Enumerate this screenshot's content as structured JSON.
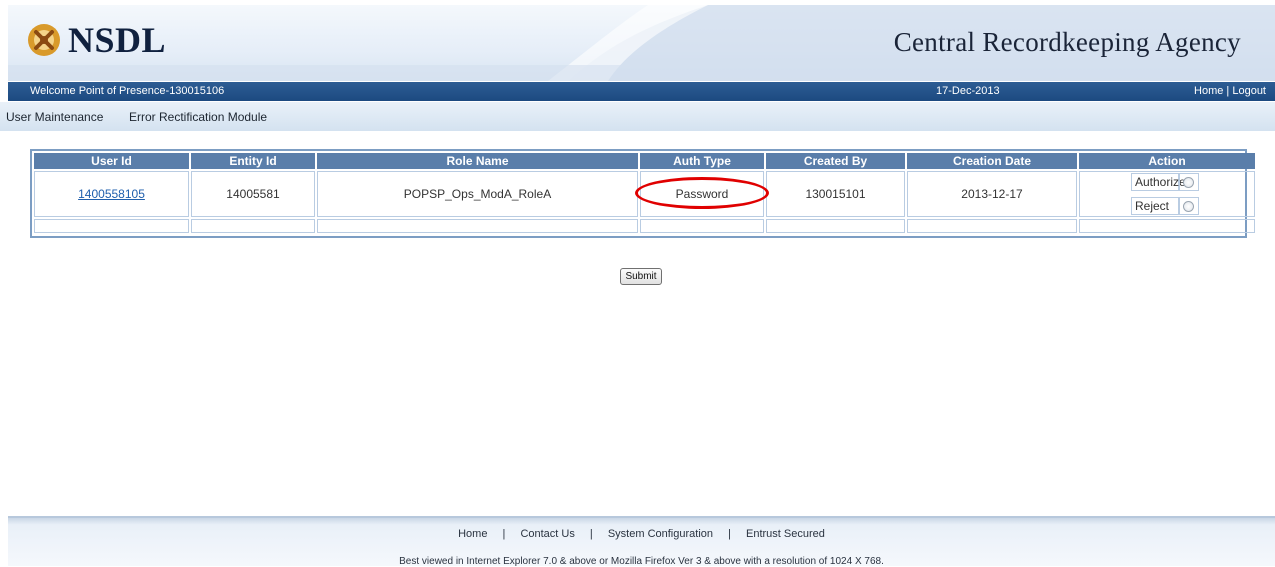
{
  "header": {
    "logo_text": "NSDL",
    "agency_title": "Central Recordkeeping Agency"
  },
  "welcome_bar": {
    "welcome_text": "Welcome Point of Presence-130015106",
    "date": "17-Dec-2013",
    "home_link": "Home",
    "separator": "|",
    "logout_link": "Logout"
  },
  "menu": {
    "items": [
      {
        "label": "User Maintenance"
      },
      {
        "label": "Error Rectification Module"
      }
    ]
  },
  "table": {
    "columns": [
      "User Id",
      "Entity Id",
      "Role Name",
      "Auth Type",
      "Created By",
      "Creation Date",
      "Action"
    ],
    "rows": [
      {
        "user_id": "1400558105",
        "entity_id": "14005581",
        "role_name": "POPSP_Ops_ModA_RoleA",
        "auth_type": "Password",
        "created_by": "130015101",
        "creation_date": "2013-12-17",
        "actions": [
          {
            "label": "Authorize",
            "selected": false
          },
          {
            "label": "Reject",
            "selected": false
          }
        ]
      }
    ]
  },
  "submit_label": "Submit",
  "footer": {
    "links": [
      "Home",
      "Contact Us",
      "System Configuration",
      "Entrust Secured"
    ],
    "separator": "|",
    "note": "Best viewed in Internet Explorer 7.0 & above or Mozilla Firefox Ver 3 & above with a resolution of 1024 X 768."
  },
  "colors": {
    "header_bar": "#1c4a80",
    "table_header": "#5a7eaa",
    "highlight_oval": "#e00000",
    "link": "#1f5fad"
  }
}
